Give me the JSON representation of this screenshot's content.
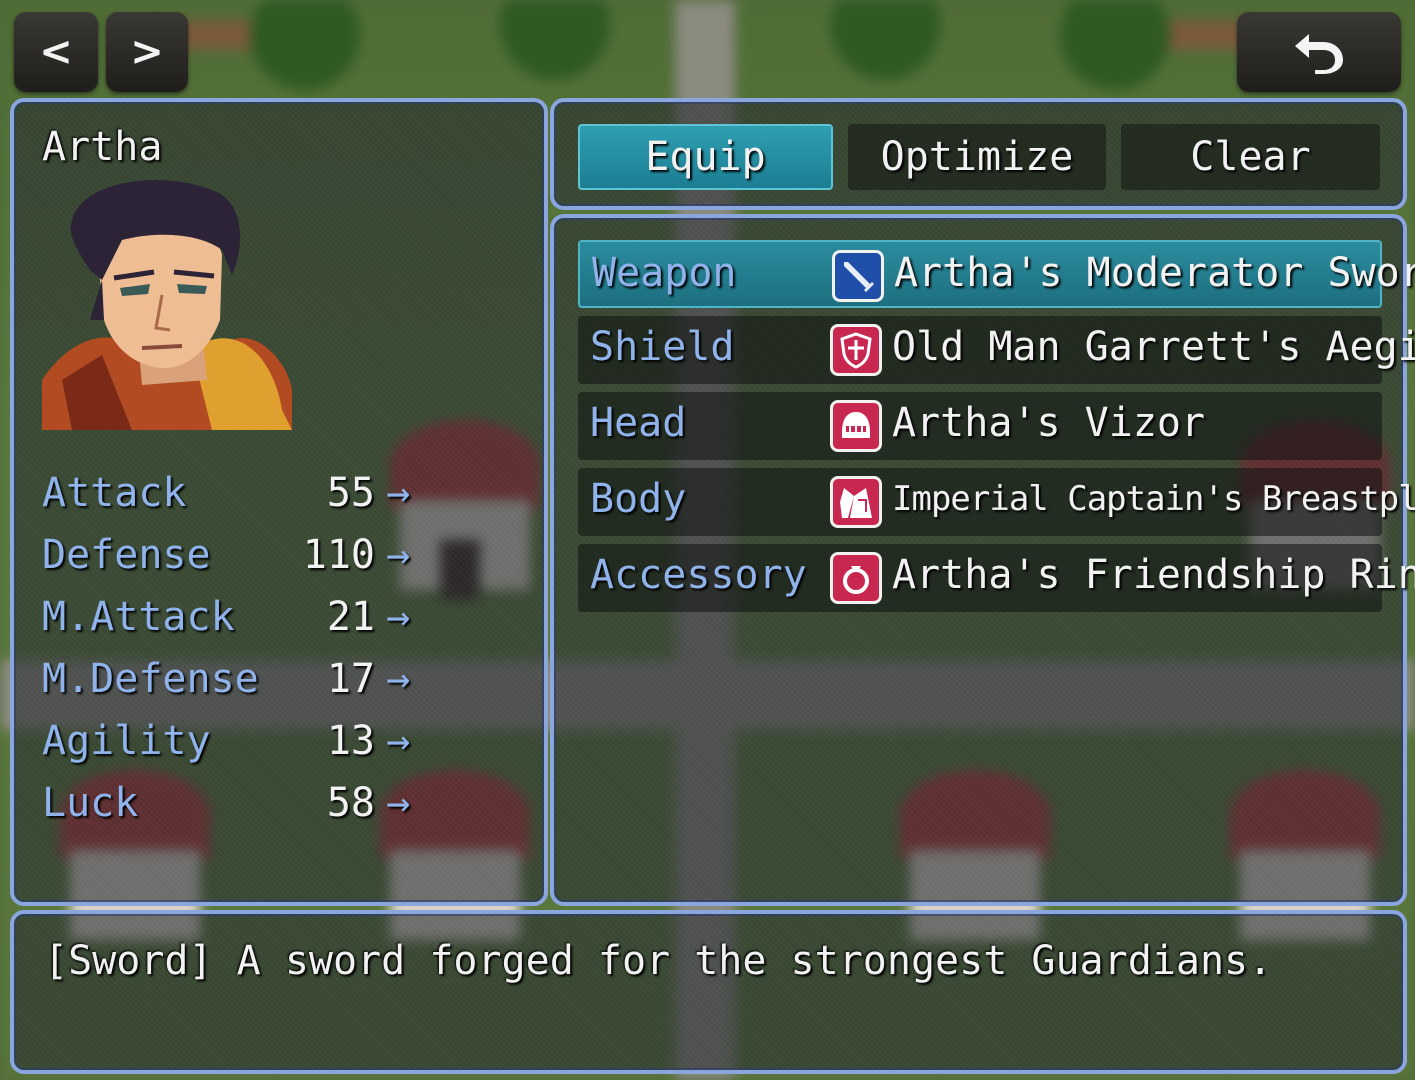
{
  "nav": {
    "prev_label": "<",
    "next_label": ">",
    "back_icon": "undo-arrow-icon"
  },
  "actor": {
    "name": "Artha",
    "portrait": "character-portrait"
  },
  "stats": [
    {
      "name": "Attack",
      "value": "55",
      "arrow": "→"
    },
    {
      "name": "Defense",
      "value": "110",
      "arrow": "→"
    },
    {
      "name": "M.Attack",
      "value": "21",
      "arrow": "→"
    },
    {
      "name": "M.Defense",
      "value": "17",
      "arrow": "→"
    },
    {
      "name": "Agility",
      "value": "13",
      "arrow": "→"
    },
    {
      "name": "Luck",
      "value": "58",
      "arrow": "→"
    }
  ],
  "commands": [
    {
      "label": "Equip",
      "selected": true
    },
    {
      "label": "Optimize",
      "selected": false
    },
    {
      "label": "Clear",
      "selected": false
    }
  ],
  "slots": [
    {
      "slot": "Weapon",
      "item": "Artha's Moderator Sword",
      "icon": "sword-icon",
      "icon_color": "#1f4fa8",
      "selected": true
    },
    {
      "slot": "Shield",
      "item": "Old Man Garrett's Aegis",
      "icon": "shield-icon",
      "icon_color": "#c8284f",
      "selected": false
    },
    {
      "slot": "Head",
      "item": "Artha's Vizor",
      "icon": "helmet-icon",
      "icon_color": "#c8284f",
      "selected": false
    },
    {
      "slot": "Body",
      "item": "Imperial Captain's Breastplate",
      "icon": "armor-icon",
      "icon_color": "#c8284f",
      "selected": false
    },
    {
      "slot": "Accessory",
      "item": "Artha's Friendship Ring",
      "icon": "ring-icon",
      "icon_color": "#c8284f",
      "selected": false
    }
  ],
  "help": {
    "text": "[Sword] A sword forged for the strongest Guardians."
  },
  "colors": {
    "window_border": "#8aa6dd",
    "system_text": "#8fb3ea",
    "selection": "#2f9fb1"
  }
}
